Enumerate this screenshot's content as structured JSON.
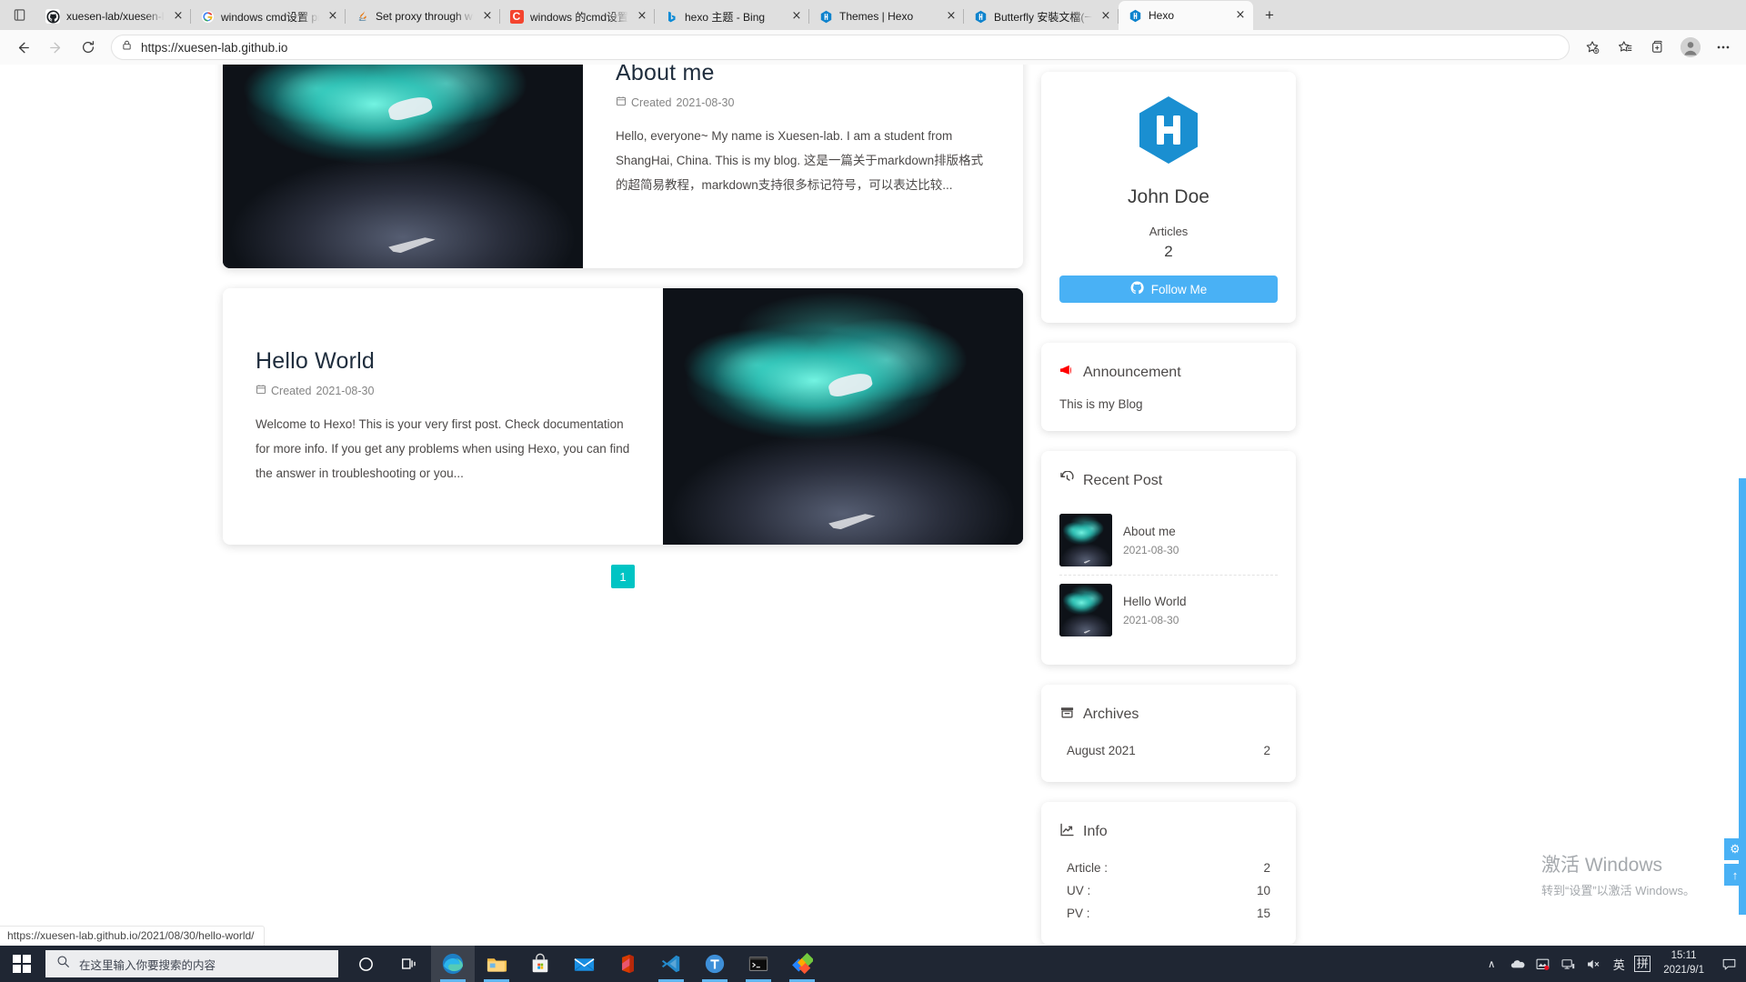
{
  "browser": {
    "tabs": [
      {
        "title": "xuesen-lab/xuesen-lab.github.io",
        "favicon": "github-icon",
        "active": false
      },
      {
        "title": "windows cmd设置 proxy - Google 搜索",
        "favicon": "google-icon",
        "active": false
      },
      {
        "title": "Set proxy through windows cmd",
        "favicon": "java-icon",
        "active": false
      },
      {
        "title": "windows 的cmd设置代理方法",
        "favicon": "csdn-icon",
        "active": false
      },
      {
        "title": "hexo 主题 - Bing",
        "favicon": "bing-icon",
        "active": false
      },
      {
        "title": "Themes | Hexo",
        "favicon": "hexo-icon",
        "active": false
      },
      {
        "title": "Butterfly 安裝文檔(一) 快速開始",
        "favicon": "hexo-icon",
        "active": false
      },
      {
        "title": "Hexo",
        "favicon": "hexo-icon",
        "active": true
      }
    ],
    "tab_close_label": "×",
    "new_tab_label": "+",
    "toolbar": {
      "back": "←",
      "forward": "→",
      "refresh": "↻",
      "url": "https://xuesen-lab.github.io",
      "lock_icon": "lock-icon",
      "favorite_icon": "add-favorite-icon",
      "favorites_icon": "favorites-icon",
      "collections_icon": "collections-icon",
      "profile_icon": "profile-icon",
      "settings_icon": "more-icon"
    },
    "status_url": "https://xuesen-lab.github.io/2021/08/30/hello-world/"
  },
  "site": {
    "posts": [
      {
        "title": "About me",
        "meta_label": "Created",
        "date": "2021-08-30",
        "excerpt": "Hello, everyone~ My name is Xuesen-lab. I am a student from ShangHai, China. This is my blog. 这是一篇关于markdown排版格式的超简易教程，markdown支持很多标记符号，可以表达比较..."
      },
      {
        "title": "Hello World",
        "meta_label": "Created",
        "date": "2021-08-30",
        "excerpt": "Welcome to Hexo! This is your very first post. Check documentation for more info. If you get any problems when using Hexo, you can find the answer in troubleshooting or you..."
      }
    ],
    "pagination": {
      "current": "1"
    },
    "sidebar": {
      "author": {
        "avatar_icon": "hexo-logo-icon",
        "name": "John Doe",
        "articles_label": "Articles",
        "articles_count": "2",
        "follow_label": "Follow Me",
        "follow_icon": "github-icon",
        "follow_color": "#49b1f5"
      },
      "announcement": {
        "title": "Announcement",
        "icon": "megaphone-icon",
        "icon_color": "#ff0000",
        "text": "This is my Blog"
      },
      "recent": {
        "title": "Recent Post",
        "icon": "history-icon",
        "items": [
          {
            "title": "About me",
            "date": "2021-08-30"
          },
          {
            "title": "Hello World",
            "date": "2021-08-30"
          }
        ]
      },
      "archives": {
        "title": "Archives",
        "icon": "archive-icon",
        "items": [
          {
            "label": "August 2021",
            "count": "2"
          }
        ]
      },
      "info": {
        "title": "Info",
        "icon": "chart-icon",
        "rows": [
          {
            "label": "Article :",
            "value": "2"
          },
          {
            "label": "UV :",
            "value": "10"
          },
          {
            "label": "PV :",
            "value": "15"
          }
        ]
      }
    },
    "float_buttons": [
      {
        "icon": "gear-icon",
        "label": "⚙"
      },
      {
        "icon": "arrow-up-icon",
        "label": "↑"
      }
    ],
    "accent_color": "#00c4c4"
  },
  "windows": {
    "watermark_line1": "激活 Windows",
    "watermark_line2": "转到“设置”以激活 Windows。",
    "taskbar": {
      "start_icon": "windows-start-icon",
      "search_placeholder": "在这里输入你要搜索的内容",
      "search_icon": "search-icon",
      "cortana_icon": "cortana-icon",
      "taskview_icon": "task-view-icon",
      "apps": [
        {
          "name": "edge-icon",
          "active": true,
          "running": true
        },
        {
          "name": "file-explorer-icon",
          "active": false,
          "running": true
        },
        {
          "name": "microsoft-store-icon",
          "active": false,
          "running": false
        },
        {
          "name": "mail-icon",
          "active": false,
          "running": false
        },
        {
          "name": "office-icon",
          "active": false,
          "running": false
        },
        {
          "name": "vscode-icon",
          "active": false,
          "running": true
        },
        {
          "name": "typora-icon",
          "active": false,
          "running": true
        },
        {
          "name": "terminal-icon",
          "active": false,
          "running": true
        },
        {
          "name": "sourcetree-icon",
          "active": false,
          "running": true
        }
      ],
      "tray": {
        "chevron": "∧",
        "onedrive_icon": "onedrive-icon",
        "photos_icon": "photos-icon",
        "network_icon": "network-icon",
        "volume_icon": "volume-muted-icon",
        "ime_lang": "英",
        "ime_mode": "拼",
        "time": "15:11",
        "date": "2021/9/1",
        "action_center_icon": "notification-icon"
      }
    }
  }
}
